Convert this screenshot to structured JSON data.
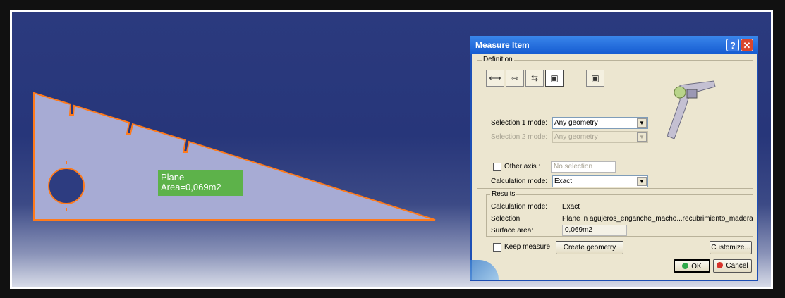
{
  "viewport": {
    "annotation": {
      "line1": "Plane",
      "line2": "Area=0,069m2"
    }
  },
  "dialog": {
    "title": "Measure Item",
    "help_glyph": "?",
    "close_glyph": "✕",
    "definition": {
      "label": "Definition",
      "selection1_label": "Selection 1 mode:",
      "selection1_value": "Any geometry",
      "selection2_label": "Selection 2 mode:",
      "selection2_value": "Any geometry",
      "other_axis_label": "Other axis :",
      "other_axis_value": "No selection",
      "calc_mode_label": "Calculation mode:",
      "calc_mode_value": "Exact"
    },
    "results": {
      "label": "Results",
      "calc_mode_label": "Calculation mode:",
      "calc_mode_value": "Exact",
      "selection_label": "Selection:",
      "selection_value": "Plane in agujeros_enganche_macho...recubrimiento_madera",
      "surface_area_label": "Surface area:",
      "surface_area_value": "0,069m2"
    },
    "keep_measure_label": "Keep measure",
    "create_geometry_label": "Create geometry",
    "customize_label": "Customize...",
    "ok_label": "OK",
    "cancel_label": "Cancel"
  },
  "colors": {
    "part_fill": "#a7abd4",
    "edge": "#ff7a1a",
    "annotation_bg": "#5db24a",
    "ok_dot": "#2ea84a",
    "cancel_dot": "#d8342c"
  }
}
